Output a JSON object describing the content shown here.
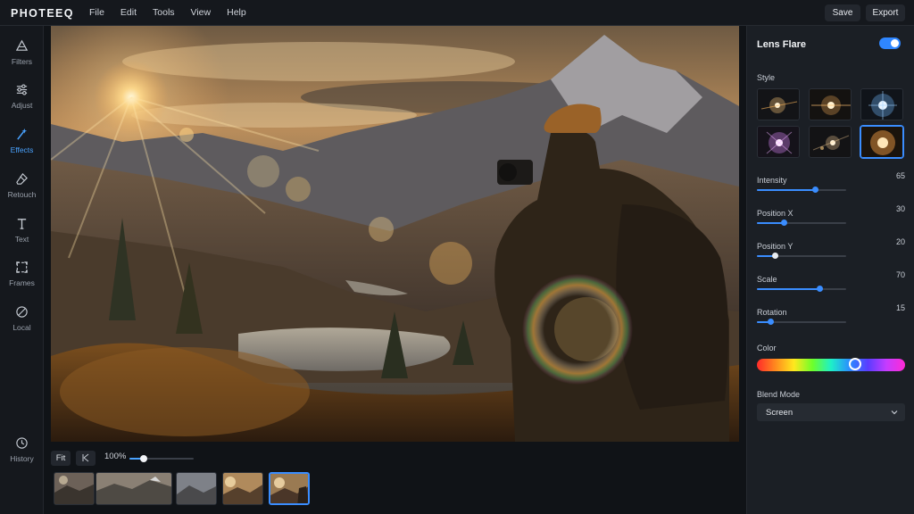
{
  "app": {
    "name": "PHOTEEQ"
  },
  "menu": [
    "File",
    "Edit",
    "Tools",
    "View",
    "Help"
  ],
  "actions": {
    "save": "Save",
    "export": "Export"
  },
  "tools": [
    {
      "label": "Filters",
      "icon": "filters-icon"
    },
    {
      "label": "Adjust",
      "icon": "adjust-sliders-icon"
    },
    {
      "label": "Effects",
      "icon": "effects-wand-icon",
      "active": true
    },
    {
      "label": "Retouch",
      "icon": "eraser-icon"
    },
    {
      "label": "Text",
      "icon": "text-icon"
    },
    {
      "label": "Frames",
      "icon": "frames-icon"
    },
    {
      "label": "Local",
      "icon": "local-brush-icon"
    }
  ],
  "history": {
    "label": "History",
    "icon": "history-icon"
  },
  "zoom": {
    "fit_label": "Fit",
    "value": "100%",
    "level": 0.22
  },
  "filmstrip": {
    "count": 6,
    "active_index": 5
  },
  "panel": {
    "title": "Lens Flare",
    "enabled": true,
    "style_label": "Style",
    "styles_count": 6,
    "active_style": 5,
    "sliders": [
      {
        "name": "Intensity",
        "value": 65
      },
      {
        "name": "Position X",
        "value": 30
      },
      {
        "name": "Position Y",
        "value": 20
      },
      {
        "name": "Scale",
        "value": 70
      },
      {
        "name": "Rotation",
        "value": 15
      }
    ],
    "color_label": "Color",
    "color_hue_position": 0.66,
    "blend_label": "Blend Mode",
    "blend_value": "Screen"
  },
  "colors": {
    "accent": "#3a8dff",
    "panel_bg": "#1b1f25",
    "app_bg": "#14171c"
  }
}
